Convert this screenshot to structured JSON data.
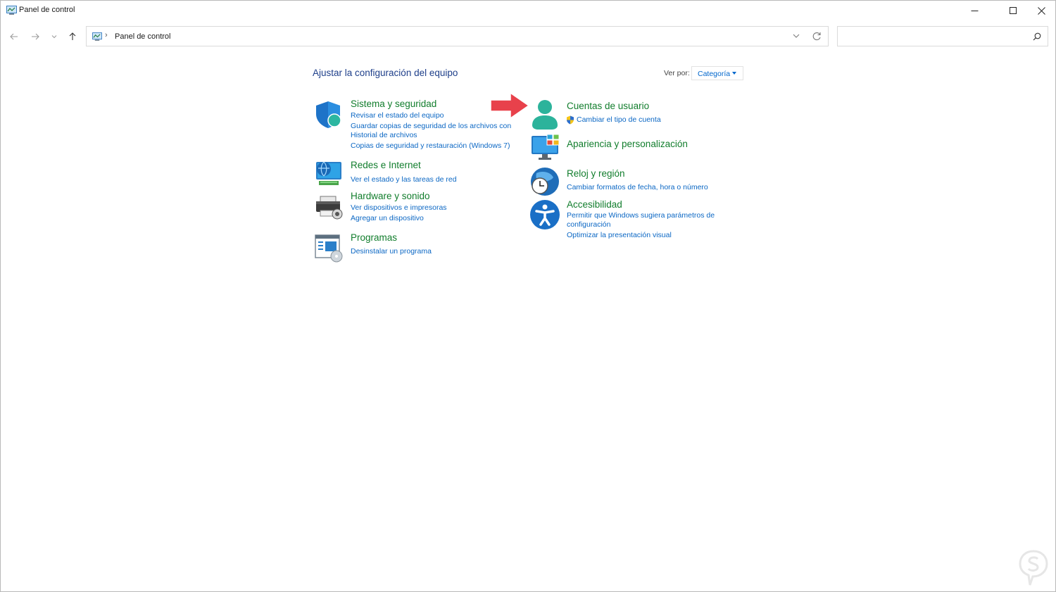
{
  "window": {
    "title": "Panel de control"
  },
  "address": {
    "path_label": "Panel de control",
    "separator": "›"
  },
  "search": {
    "placeholder": ""
  },
  "main": {
    "title": "Ajustar la configuración del equipo",
    "view_by_label": "Ver por:",
    "view_by_value": "Categoría"
  },
  "categories": [
    {
      "title": "Sistema y seguridad",
      "links": [
        "Revisar el estado del equipo",
        "Guardar copias de seguridad de los archivos con",
        "Historial de archivos",
        "Copias de seguridad y restauración (Windows 7)"
      ]
    },
    {
      "title": "Redes e Internet",
      "links": [
        "Ver el estado y las tareas de red"
      ]
    },
    {
      "title": "Hardware y sonido",
      "links": [
        "Ver dispositivos e impresoras",
        "Agregar un dispositivo"
      ]
    },
    {
      "title": "Programas",
      "links": [
        "Desinstalar un programa"
      ]
    },
    {
      "title": "Cuentas de usuario",
      "links": [
        "Cambiar el tipo de cuenta"
      ]
    },
    {
      "title": "Apariencia y personalización",
      "links": []
    },
    {
      "title": "Reloj y región",
      "links": [
        "Cambiar formatos de fecha, hora o número"
      ]
    },
    {
      "title": "Accesibilidad",
      "links": [
        "Permitir que Windows sugiera parámetros de",
        "configuración",
        "Optimizar la presentación visual"
      ]
    }
  ],
  "colors": {
    "category_title": "#117d2c",
    "link": "#0b67c4",
    "heading": "#1e3f8a",
    "arrow": "#e8414b"
  }
}
